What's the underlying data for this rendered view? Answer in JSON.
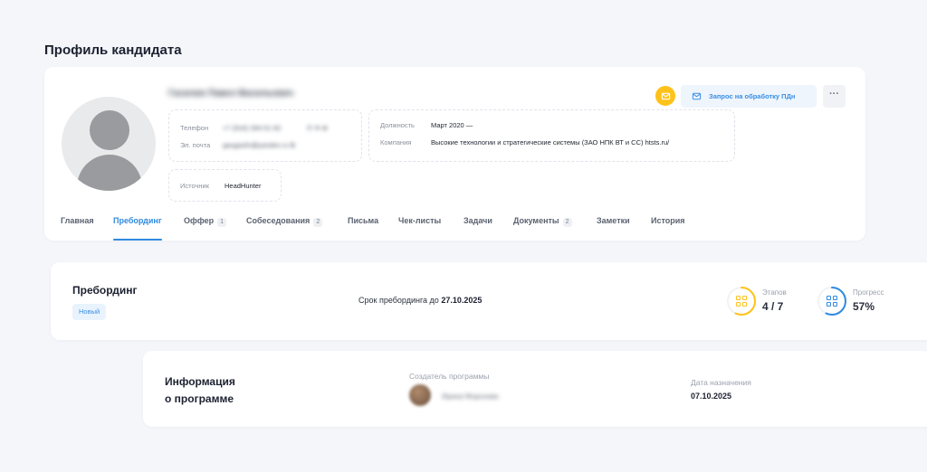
{
  "page": {
    "title": "Профиль кандидата"
  },
  "candidate": {
    "name": "Гасилин Павел Васильевич",
    "contacts": {
      "phone_label": "Телефон",
      "phone_value": "+7 (916) 284-51-92",
      "phone_extra": "✆ ✉ ⊕",
      "email_label": "Эл. почта",
      "email_value": "gasgasiln@yandex.ru ⧉"
    },
    "job": {
      "position_label": "Должность",
      "position_value": "Март 2020 —",
      "company_label": "Компания",
      "company_value": "Высокие технологии и стратегические системы (ЗАО НПК ВТ и СС) htsts.ru/"
    },
    "source": {
      "label": "Источник",
      "value": "HeadHunter"
    }
  },
  "actions": {
    "pd_request_label": "Запрос на обработку ПДн",
    "more_label": "···"
  },
  "tabs": [
    {
      "label": "Главная"
    },
    {
      "label": "Пребординг",
      "active": true
    },
    {
      "label": "Оффер",
      "count": "1"
    },
    {
      "label": "Собеседования",
      "count": "2"
    },
    {
      "label": "Письма"
    },
    {
      "label": "Чек-листы"
    },
    {
      "label": "Задачи"
    },
    {
      "label": "Документы",
      "count": "2"
    },
    {
      "label": "Заметки"
    },
    {
      "label": "История"
    }
  ],
  "preboarding": {
    "title": "Пребординг",
    "status": "Новый",
    "deadline_text": "Срок пребординга до",
    "deadline_date": "27.10.2025",
    "stages_label": "Этапов",
    "stages_value": "4 / 7",
    "stages_fraction": 0.57,
    "progress_label": "Прогресс",
    "progress_value": "57%",
    "progress_fraction": 0.57
  },
  "program_info": {
    "title_line1": "Информация",
    "title_line2": "о программе",
    "creator_label": "Создатель программы",
    "creator_name": "Ирина Морозова",
    "date_label": "Дата назначения",
    "date_value": "07.10.2025"
  },
  "colors": {
    "accent": "#2f8ae0",
    "stages_ring": "#ffc21a",
    "progress_ring": "#2f8ae0",
    "background": "#f4f6fa"
  }
}
